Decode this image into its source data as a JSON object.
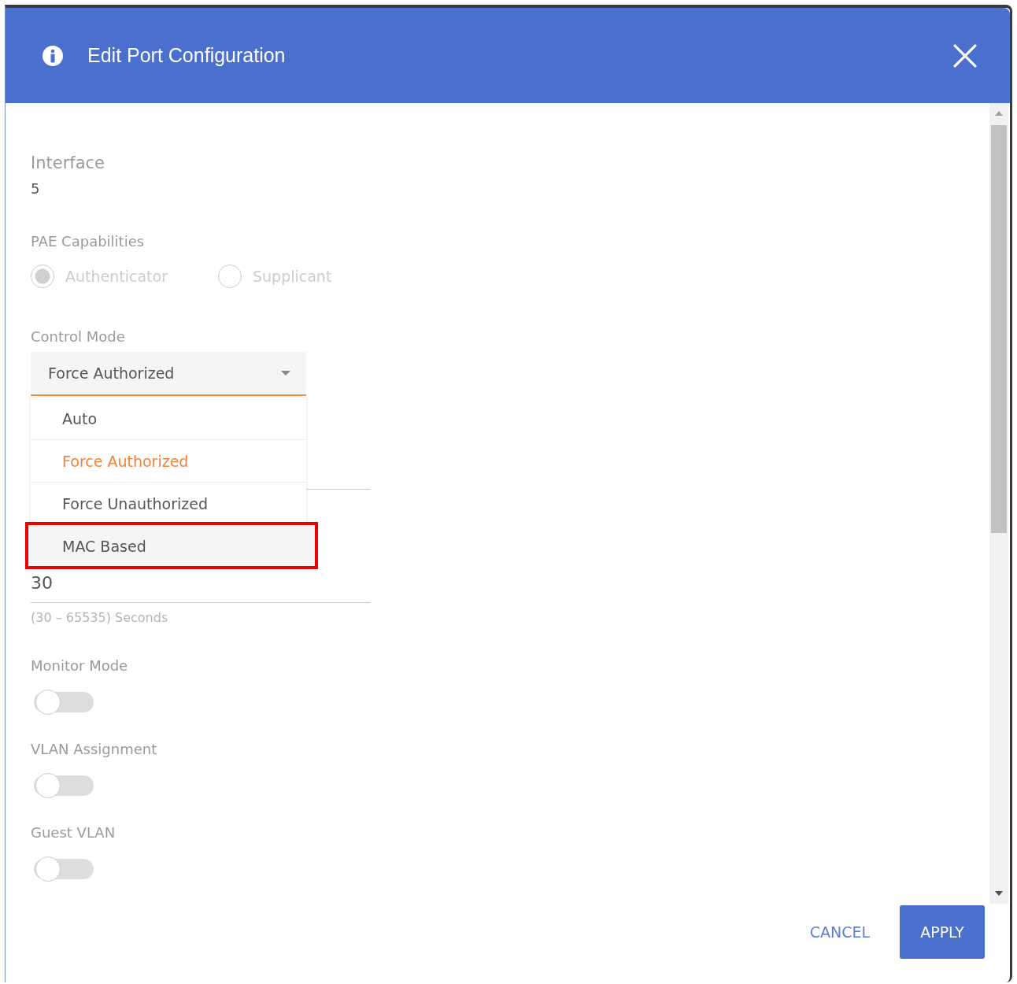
{
  "dialog": {
    "title": "Edit Port Configuration"
  },
  "interface": {
    "label": "Interface",
    "value": "5"
  },
  "pae_capabilities": {
    "label": "PAE Capabilities",
    "disabled": true,
    "options": [
      {
        "label": "Authenticator",
        "selected": true
      },
      {
        "label": "Supplicant",
        "selected": false
      }
    ]
  },
  "control_mode": {
    "label": "Control Mode",
    "value": "Force Authorized",
    "expanded": true,
    "options": [
      {
        "label": "Auto",
        "selected": false,
        "highlighted": false
      },
      {
        "label": "Force Authorized",
        "selected": true,
        "highlighted": false
      },
      {
        "label": "Force Unauthorized",
        "selected": false,
        "highlighted": false
      },
      {
        "label": "MAC Based",
        "selected": false,
        "highlighted": true
      }
    ]
  },
  "timeout_field": {
    "value": "30",
    "hint": "(30 – 65535) Seconds"
  },
  "toggles": [
    {
      "label": "Monitor Mode",
      "on": false
    },
    {
      "label": "VLAN Assignment",
      "on": false
    },
    {
      "label": "Guest VLAN",
      "on": false
    }
  ],
  "buttons": [
    {
      "label": "CANCEL",
      "kind": "text"
    },
    {
      "label": "APPLY",
      "kind": "primary"
    }
  ]
}
